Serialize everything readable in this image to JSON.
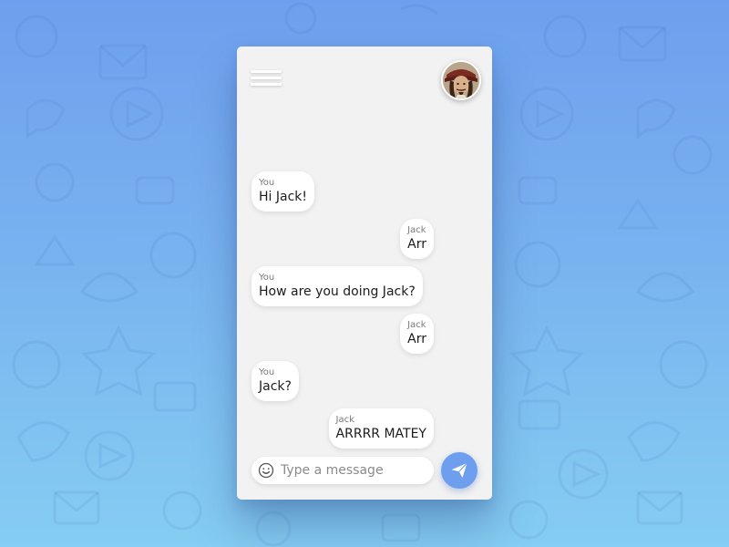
{
  "header": {
    "menu_icon": "hamburger-menu-icon",
    "avatar_icon": "contact-avatar"
  },
  "messages": [
    {
      "sender": "You",
      "text": "Hi Jack!",
      "side": "left"
    },
    {
      "sender": "Jack",
      "text": "Arr",
      "side": "right"
    },
    {
      "sender": "You",
      "text": "How are you doing Jack?",
      "side": "left"
    },
    {
      "sender": "Jack",
      "text": "Arr",
      "side": "right"
    },
    {
      "sender": "You",
      "text": "Jack?",
      "side": "left"
    },
    {
      "sender": "Jack",
      "text": "ARRRR MATEY",
      "side": "right"
    }
  ],
  "composer": {
    "placeholder": "Type a message",
    "value": "",
    "emoji_icon": "smiley-icon",
    "send_icon": "paper-plane-icon"
  },
  "colors": {
    "accent": "#6e9fee",
    "background_top": "#6e9fee",
    "background_bottom": "#85cdf2",
    "panel": "#f2f2f2",
    "bubble": "#ffffff"
  }
}
